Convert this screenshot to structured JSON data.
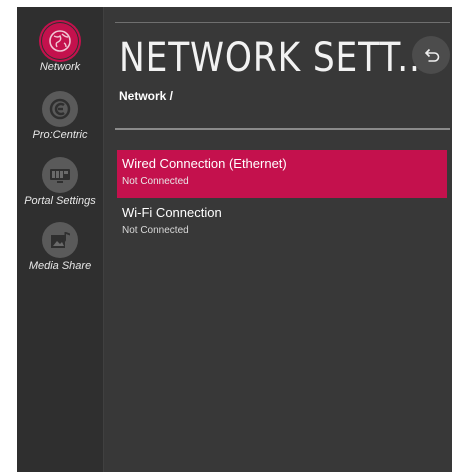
{
  "colors": {
    "accent": "#c4114d",
    "panel": "#383838",
    "sidebar": "#2f2f2f"
  },
  "sidebar": {
    "items": [
      {
        "label": "Network",
        "icon": "globe-icon",
        "active": true
      },
      {
        "label": "Pro:Centric",
        "icon": "procentric-icon",
        "active": false
      },
      {
        "label": "Portal Settings",
        "icon": "portal-icon",
        "active": false
      },
      {
        "label": "Media Share",
        "icon": "media-share-icon",
        "active": false
      }
    ]
  },
  "header": {
    "title": "NETWORK SETT...",
    "breadcrumb": "Network /",
    "back_icon": "back-arrow-icon"
  },
  "options": [
    {
      "title": "Wired Connection (Ethernet)",
      "status": "Not Connected",
      "selected": true
    },
    {
      "title": "Wi-Fi Connection",
      "status": "Not Connected",
      "selected": false
    }
  ]
}
